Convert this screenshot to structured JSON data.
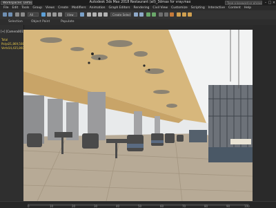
{
  "window": {
    "workspace": "Workspaces: Default",
    "title": "Autodesk 3ds Max 2018    Restaurant (all)_3dmax for vray.max",
    "search_placeholder": "Type a keyword or phrase",
    "controls": [
      "–",
      "□",
      "×"
    ]
  },
  "menu": [
    "File",
    "Edit",
    "Tools",
    "Group",
    "Views",
    "Create",
    "Modifiers",
    "Animation",
    "Graph Editors",
    "Rendering",
    "Civil View",
    "Customize",
    "Scripting",
    "Interactive",
    "Content",
    "Help"
  ],
  "toolbar": {
    "filter_dropdown": "All",
    "view_dropdown": "View",
    "selection_set": "Create Selection Se"
  },
  "ribbon_tabs": [
    "Selection",
    "Object Paint",
    "Populate"
  ],
  "viewport": {
    "label": "[+] [Camera001 ] [ Realistic ] [ Edged Faces ]",
    "stats": {
      "header": "Total",
      "polys_label": "Polys:",
      "polys_value": "21,869,508",
      "verts_label": "Verts:",
      "verts_value": "14,435,860"
    }
  },
  "timeline": {
    "ticks": [
      "0",
      "10",
      "20",
      "30",
      "40",
      "50",
      "60",
      "70",
      "80",
      "90",
      "100"
    ]
  },
  "colors": {
    "ui_dark": "#2b2b2b",
    "ceiling_wood": "#d7b77c",
    "floor_wood": "#b7aa96",
    "column_stone": "#9b9b9d",
    "booth_blue": "#4a5866",
    "stats_yellow": "#e8c84a"
  },
  "icons": [
    "undo-icon",
    "redo-icon",
    "link-icon",
    "unlink-icon",
    "select-icon",
    "move-icon",
    "rotate-icon",
    "scale-icon",
    "snap-icon",
    "mirror-icon",
    "align-icon",
    "render-setup-icon",
    "render-icon"
  ]
}
